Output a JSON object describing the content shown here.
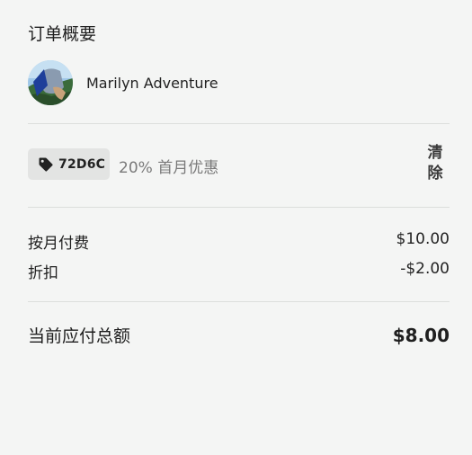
{
  "order_summary": {
    "title": "订单概要",
    "creator": {
      "name": "Marilyn Adventure",
      "avatar": "avatar-photo"
    },
    "coupon": {
      "icon": "tag-icon",
      "code": "72D6C",
      "description": "20% 首月优惠",
      "clear_label": "清除"
    },
    "lines": [
      {
        "label": "按月付费",
        "amount": "$10.00"
      },
      {
        "label": "折扣",
        "amount": "-$2.00"
      }
    ],
    "total": {
      "label": "当前应付总额",
      "amount": "$8.00"
    }
  },
  "colors": {
    "background": "#f4f5f4",
    "divider": "#dcdedc",
    "chip": "#e3e4e3",
    "muted_text": "#7a7a7a"
  }
}
